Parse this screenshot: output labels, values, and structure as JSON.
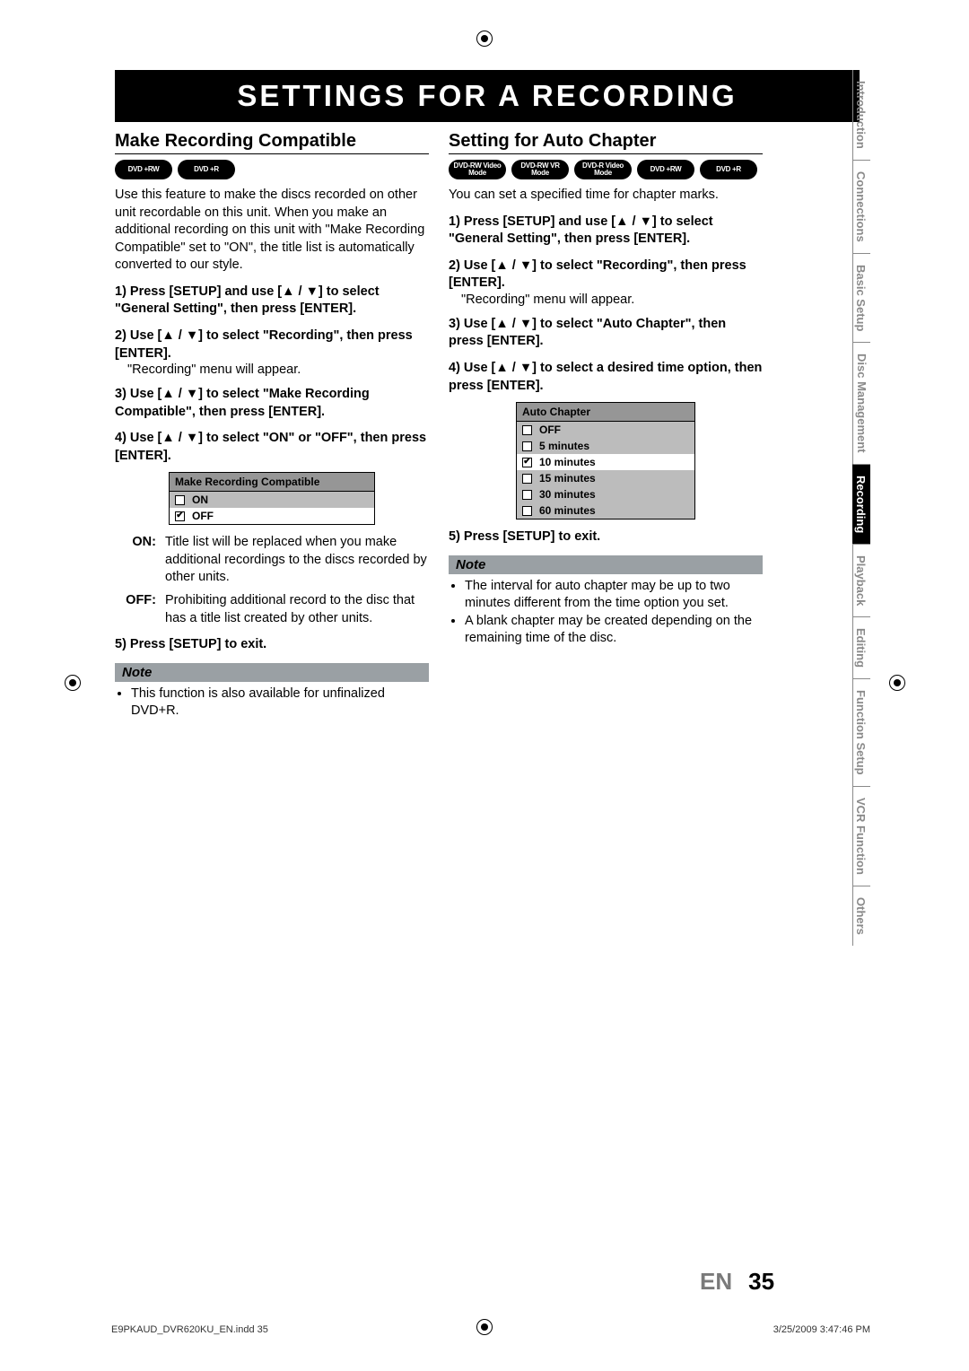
{
  "title": "SETTINGS FOR A RECORDING",
  "left": {
    "heading": "Make Recording Compatible",
    "badges": [
      "DVD +RW",
      "DVD +R"
    ],
    "intro": "Use this feature to make the discs recorded on other unit recordable on this unit. When you make an additional recording on this unit with \"Make Recording Compatible\" set to \"ON\", the title list is automatically converted to our style.",
    "steps": [
      "Press [SETUP] and use [▲ / ▼] to select \"General Setting\", then press [ENTER].",
      "Use [▲ / ▼] to select \"Recording\", then press [ENTER].",
      "Use [▲ / ▼] to select \"Make Recording Compatible\", then press [ENTER].",
      "Use [▲ / ▼] to select \"ON\" or \"OFF\", then press [ENTER]."
    ],
    "step2_sub": "\"Recording\" menu will appear.",
    "osd": {
      "title": "Make Recording Compatible",
      "rows": [
        {
          "label": "ON",
          "checked": false,
          "selected": false
        },
        {
          "label": "OFF",
          "checked": true,
          "selected": true
        }
      ]
    },
    "defs": [
      {
        "k": "ON:",
        "v": "Title list will be replaced when you make additional recordings to the discs recorded by other units."
      },
      {
        "k": "OFF:",
        "v": "Prohibiting additional record to the disc that has a title list created by other units."
      }
    ],
    "step5": "Press [SETUP] to exit.",
    "note_label": "Note",
    "notes": [
      "This function is also available for unfinalized DVD+R."
    ]
  },
  "right": {
    "heading": "Setting for Auto Chapter",
    "badges": [
      "DVD-RW Video Mode",
      "DVD-RW VR Mode",
      "DVD-R Video Mode",
      "DVD +RW",
      "DVD +R"
    ],
    "intro": "You can set a specified time for chapter marks.",
    "steps": [
      "Press [SETUP] and use [▲ / ▼] to select \"General Setting\", then press [ENTER].",
      "Use [▲ / ▼] to select \"Recording\", then press [ENTER].",
      "Use [▲ / ▼] to select \"Auto Chapter\", then press [ENTER].",
      "Use [▲ / ▼] to select a desired time option, then press [ENTER]."
    ],
    "step2_sub": "\"Recording\" menu will appear.",
    "osd": {
      "title": "Auto Chapter",
      "rows": [
        {
          "label": "OFF",
          "checked": false,
          "selected": false
        },
        {
          "label": "5 minutes",
          "checked": false,
          "selected": false
        },
        {
          "label": "10 minutes",
          "checked": true,
          "selected": true
        },
        {
          "label": "15 minutes",
          "checked": false,
          "selected": false
        },
        {
          "label": "30 minutes",
          "checked": false,
          "selected": false
        },
        {
          "label": "60 minutes",
          "checked": false,
          "selected": false
        }
      ]
    },
    "step5": "Press [SETUP] to exit.",
    "note_label": "Note",
    "notes": [
      "The interval for auto chapter may be up to two minutes different from the time option you set.",
      "A blank chapter may be created depending on the remaining time of the disc."
    ]
  },
  "tabs": [
    "Introduction",
    "Connections",
    "Basic Setup",
    "Disc Management",
    "Recording",
    "Playback",
    "Editing",
    "Function Setup",
    "VCR Function",
    "Others"
  ],
  "active_tab": "Recording",
  "page_lang": "EN",
  "page_num": "35",
  "footer_left": "E9PKAUD_DVR620KU_EN.indd   35",
  "footer_right": "3/25/2009   3:47:46 PM"
}
